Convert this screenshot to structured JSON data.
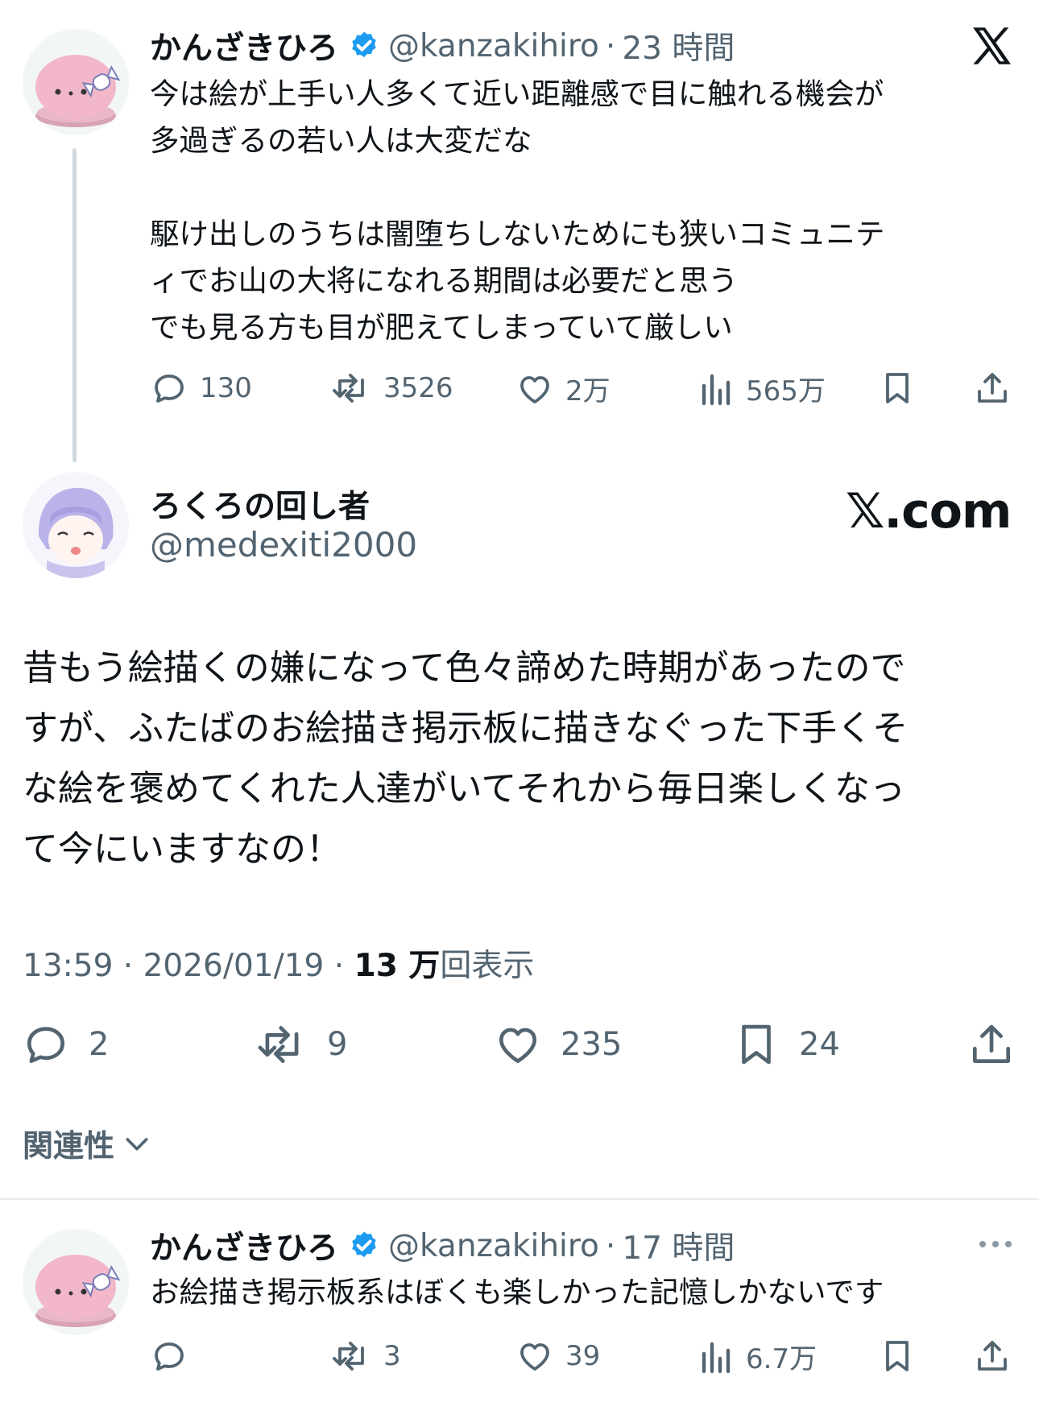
{
  "quoted_tweet": {
    "display_name": "かんざきひろ",
    "handle": "@kanzakihiro",
    "separator": "·",
    "time": "23 時間",
    "text_lines": [
      "今は絵が上手い人多くて近い距離感で目に触れる機会が",
      "多過ぎるの若い人は大変だな",
      "",
      "駆け出しのうちは闇堕ちしないためにも狭いコミュニテ",
      "ィでお山の大将になれる期間は必要だと思う",
      "でも見る方も目が肥えてしまっていて厳しい"
    ],
    "stats": {
      "replies": "130",
      "reposts": "3526",
      "likes": "2万",
      "views": "565万"
    }
  },
  "main_tweet": {
    "display_name": "ろくろの回し者",
    "handle": "@medexiti2000",
    "watermark": "𝕏.com",
    "text_lines": [
      "昔もう絵描くの嫌になって色々諦めた時期があったので",
      "すが、ふたばのお絵描き掲示板に描きなぐった下手くそ",
      "な絵を褒めてくれた人達がいてそれから毎日楽しくなっ",
      "て今にいますなの！"
    ],
    "timestamp": "13:59 · 2026/01/19 · ",
    "views_count": "13 万",
    "views_label": "回表示",
    "stats": {
      "replies": "2",
      "reposts": "9",
      "likes": "235",
      "bookmarks": "24"
    }
  },
  "relevance": {
    "label": "関連性"
  },
  "reply_tweet": {
    "display_name": "かんざきひろ",
    "handle": "@kanzakihiro",
    "separator": "·",
    "time": "17 時間",
    "text": "お絵描き掲示板系はぼくも楽しかった記憶しかないです",
    "stats": {
      "replies": "",
      "reposts": "3",
      "likes": "39",
      "views": "6.7万"
    }
  },
  "colors": {
    "text": "#0f1419",
    "muted": "#536471",
    "verified": "#1d9bf0",
    "thread_line": "#cfd9de"
  }
}
